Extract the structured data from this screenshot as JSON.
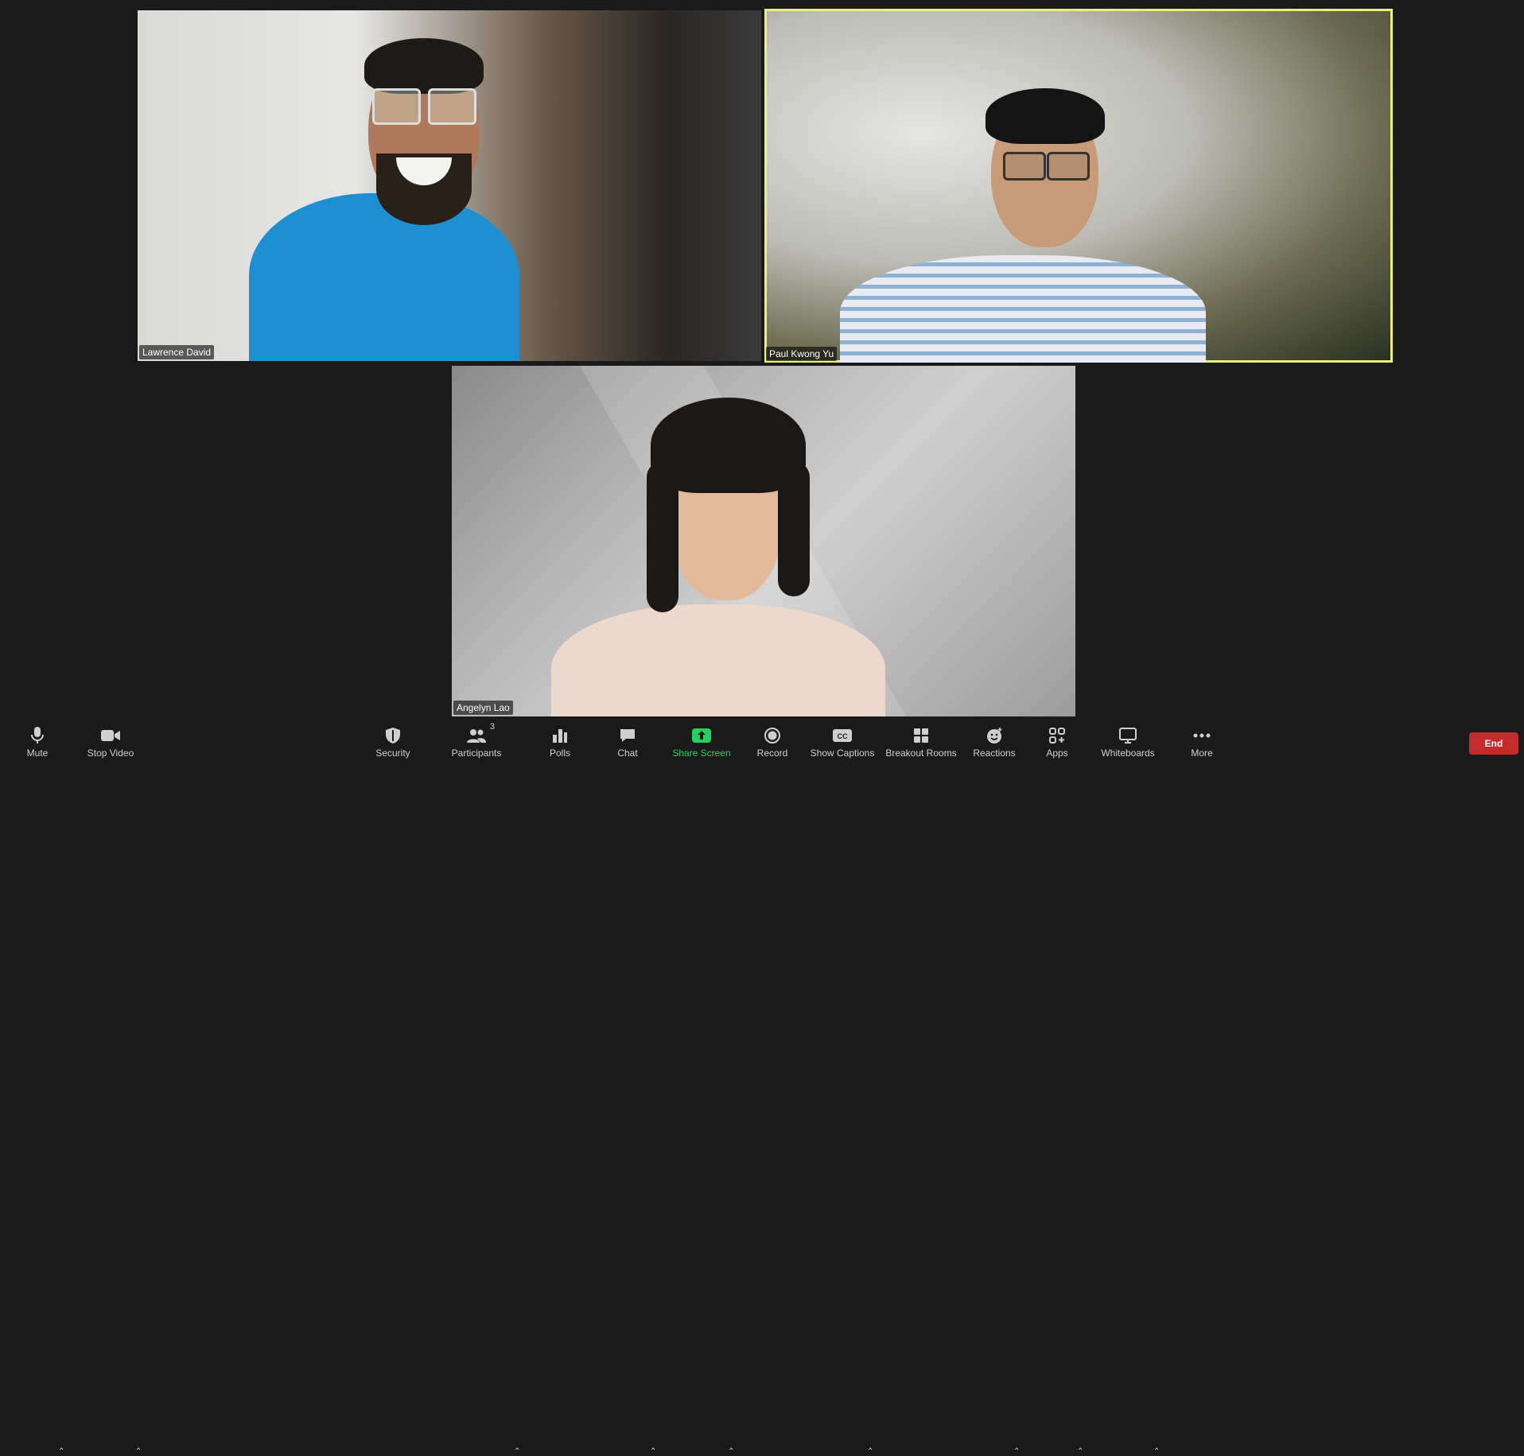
{
  "participants": [
    {
      "name": "Lawrence David"
    },
    {
      "name": "Paul Kwong Yu"
    },
    {
      "name": "Angelyn Lao"
    }
  ],
  "toolbar": {
    "mute": "Mute",
    "stop_video": "Stop Video",
    "security": "Security",
    "participants": "Participants",
    "participants_count": "3",
    "polls": "Polls",
    "chat": "Chat",
    "share_screen": "Share Screen",
    "record": "Record",
    "show_captions": "Show Captions",
    "breakout_rooms": "Breakout Rooms",
    "reactions": "Reactions",
    "apps": "Apps",
    "whiteboards": "Whiteboards",
    "more": "More",
    "end": "End"
  },
  "colors": {
    "active_speaker_border": "#e9f07a",
    "share_screen": "#23d160",
    "end_button": "#c52b2b"
  },
  "icons": {
    "mute": "microphone-icon",
    "stop_video": "video-camera-icon",
    "security": "shield-icon",
    "participants": "people-icon",
    "polls": "bar-chart-icon",
    "chat": "speech-bubble-icon",
    "share_screen": "share-arrow-icon",
    "record": "record-icon",
    "show_captions": "cc-icon",
    "breakout_rooms": "grid-icon",
    "reactions": "smiley-icon",
    "apps": "apps-icon",
    "whiteboards": "whiteboard-icon",
    "more": "ellipsis-icon"
  }
}
